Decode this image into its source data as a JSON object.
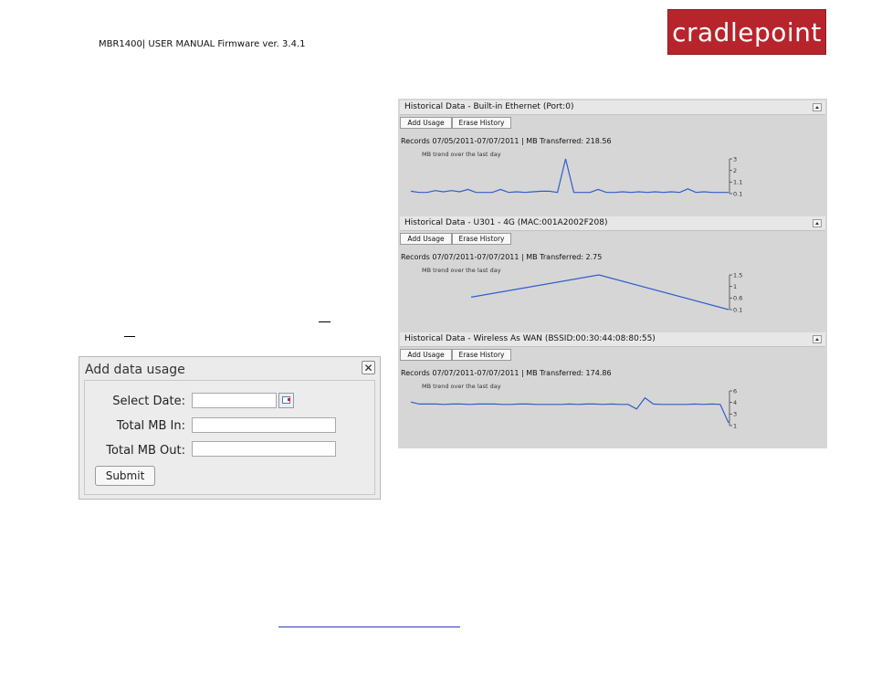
{
  "header": {
    "manual_title": "MBR1400| USER MANUAL Firmware ver. 3.4.1",
    "logo_text": "cradlepoint"
  },
  "dialog": {
    "title": "Add data usage",
    "close_label": "✕",
    "fields": [
      {
        "label": "Select Date:",
        "value": ""
      },
      {
        "label": "Total MB In:",
        "value": ""
      },
      {
        "label": "Total MB Out:",
        "value": ""
      }
    ],
    "submit_label": "Submit"
  },
  "history": {
    "add_usage_label": "Add Usage",
    "erase_history_label": "Erase History",
    "trend_label": "MB trend over the last day",
    "sections": [
      {
        "title": "Historical Data - Built-in Ethernet (Port:0)",
        "records": "Records 07/05/2011-07/07/2011 | MB Transferred: 218.56",
        "ticks": [
          "3",
          "2",
          "1.1",
          "0.1"
        ],
        "tick_values": [
          3,
          2,
          1.1,
          0.1
        ],
        "y_range": [
          0.1,
          3
        ],
        "points": [
          0.3,
          0.2,
          0.2,
          0.35,
          0.25,
          0.35,
          0.25,
          0.45,
          0.2,
          0.2,
          0.2,
          0.45,
          0.2,
          0.25,
          0.2,
          0.25,
          0.3,
          0.3,
          0.2,
          3.0,
          0.2,
          0.2,
          0.2,
          0.45,
          0.2,
          0.2,
          0.25,
          0.2,
          0.25,
          0.2,
          0.25,
          0.2,
          0.25,
          0.2,
          0.5,
          0.2,
          0.25,
          0.2,
          0.2,
          0.2
        ]
      },
      {
        "title": "Historical Data - U301 - 4G (MAC:001A2002F208)",
        "records": "Records 07/07/2011-07/07/2011 | MB Transferred: 2.75",
        "ticks": [
          "1.5",
          "1",
          "0.6",
          "0.1"
        ],
        "tick_values": [
          1.5,
          1,
          0.6,
          0.1
        ],
        "y_range": [
          0.1,
          1.5
        ],
        "start_index": 1,
        "points_count": 3,
        "points": [
          0.6,
          1.5,
          0.1
        ]
      },
      {
        "title": "Historical Data - Wireless As WAN (BSSID:00:30:44:08:80:55)",
        "records": "Records 07/07/2011-07/07/2011 | MB Transferred: 174.86",
        "ticks": [
          "6",
          "4",
          "3",
          "1"
        ],
        "tick_values": [
          6,
          4,
          3,
          1
        ],
        "y_range": [
          1,
          6
        ],
        "points": [
          4.4,
          4.1,
          4.1,
          4.1,
          4.05,
          4.1,
          4.1,
          4.05,
          4.1,
          4.1,
          4.1,
          4.05,
          4.05,
          4.1,
          4.1,
          4.05,
          4.05,
          4.05,
          4.05,
          4.1,
          4.05,
          4.1,
          4.1,
          4.05,
          4.1,
          4.05,
          4.05,
          3.4,
          5.0,
          4.1,
          4.05,
          4.05,
          4.05,
          4.05,
          4.1,
          4.05,
          4.1,
          4.05,
          1.4
        ]
      }
    ]
  }
}
